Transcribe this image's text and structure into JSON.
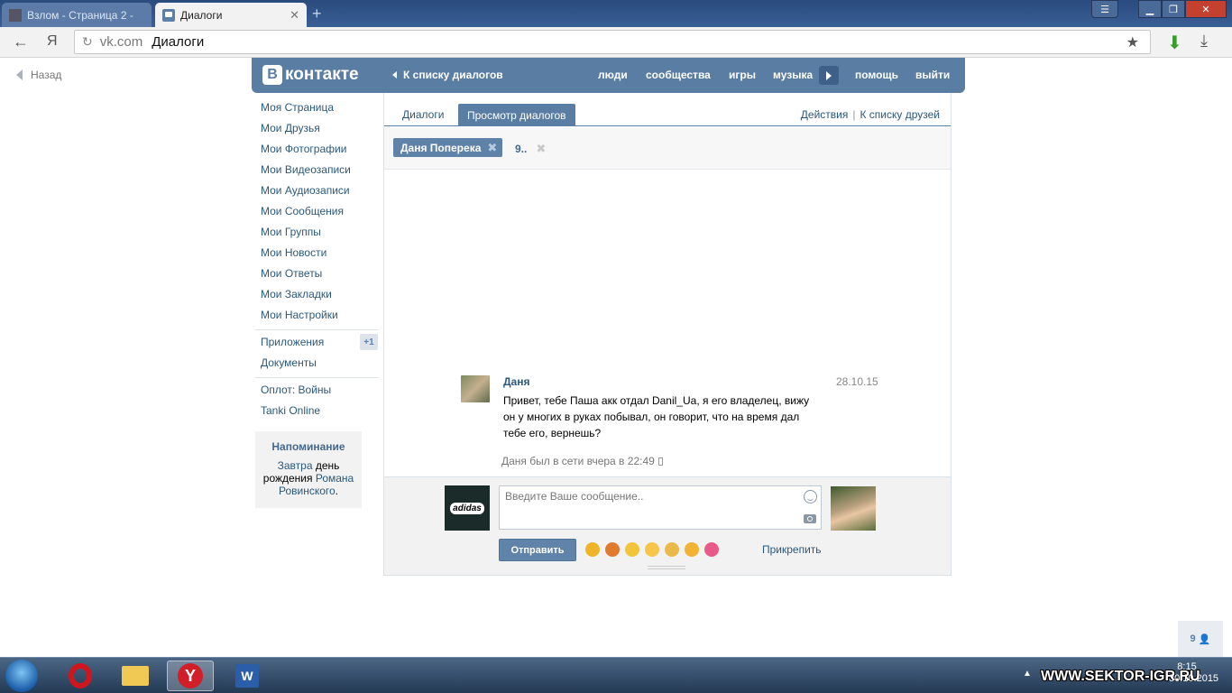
{
  "browser": {
    "tabs": [
      {
        "title": "Взлом - Страница 2 -",
        "active": false
      },
      {
        "title": "Диалоги",
        "active": true
      }
    ],
    "address_domain": "vk.com",
    "address_title": "Диалоги",
    "ya_label": "Я"
  },
  "page": {
    "back_label": "Назад"
  },
  "header": {
    "logo_text": "контакте",
    "logo_letter": "В",
    "dialogs_back": "К списку диалогов",
    "nav": [
      "люди",
      "сообщества",
      "игры",
      "музыка",
      "помощь",
      "выйти"
    ]
  },
  "sidebar": {
    "items": [
      "Моя Страница",
      "Мои Друзья",
      "Мои Фотографии",
      "Мои Видеозаписи",
      "Мои Аудиозаписи",
      "Мои Сообщения",
      "Мои Группы",
      "Мои Новости",
      "Мои Ответы",
      "Мои Закладки",
      "Мои Настройки"
    ],
    "apps_label": "Приложения",
    "apps_badge": "+1",
    "docs_label": "Документы",
    "games": [
      "Оплот: Войны",
      "Tanki Online"
    ],
    "reminder": {
      "title": "Напоминание",
      "tomorrow": "Завтра",
      "text_mid": " день рождения ",
      "person": "Романа Ровинского",
      "end": "."
    }
  },
  "dialogs": {
    "tab_dialogs": "Диалоги",
    "tab_view": "Просмотр диалогов",
    "actions": "Действия",
    "separator": "|",
    "friends_list": "К списку друзей",
    "chip_active": "Даня Поперека",
    "chip_other": "9.."
  },
  "message": {
    "author": "Даня",
    "date": "28.10.15",
    "text": "Привет, тебе Паша акк отдал Danil_Ua, я его владелец, вижу он у многих в руках побывал, он говорит, что на время дал тебе его, вернешь?",
    "last_seen": "Даня был в сети вчера в 22:49"
  },
  "compose": {
    "placeholder": "Введите Ваше сообщение..",
    "value": "",
    "send_label": "Отправить",
    "attach_label": "Прикрепить",
    "my_avatar_text": "adidas",
    "emoji_colors": [
      "#f0b429",
      "#e07a2e",
      "#f3c33a",
      "#f6c54a",
      "#e9b949",
      "#f2b233",
      "#e85a8a"
    ]
  },
  "online_counter": "9",
  "taskbar": {
    "watermark": "WWW.SEKTOR-IGR.RU",
    "time": "8:15",
    "date": "30.10.2015"
  }
}
